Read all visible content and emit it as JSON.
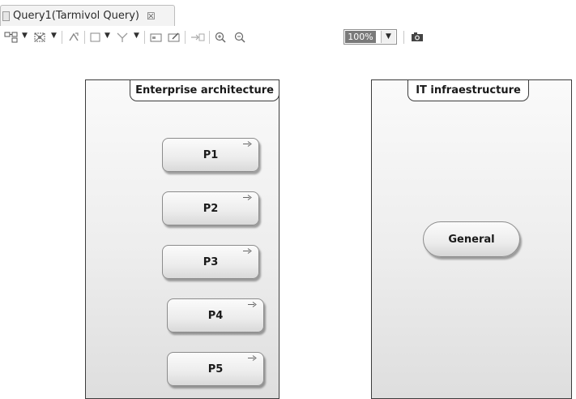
{
  "tab": {
    "title": "Query1(Tarmivol Query)",
    "close_symbol": "☒"
  },
  "toolbar": {
    "icons": [
      "layout-icon",
      "auto-layout-icon",
      "refresh-icon",
      "shape-icon",
      "filter-icon",
      "view-icon",
      "edit-view-icon",
      "export-icon",
      "zoom-in-icon",
      "zoom-out-icon",
      "camera-icon"
    ],
    "zoom_level": "100%"
  },
  "diagram": {
    "containers": [
      {
        "title": "Enterprise architecture",
        "nodes": [
          {
            "label": "P1",
            "icon": "process-arrow-icon"
          },
          {
            "label": "P2",
            "icon": "process-arrow-icon"
          },
          {
            "label": "P3",
            "icon": "process-arrow-icon"
          },
          {
            "label": "P4",
            "icon": "process-arrow-icon"
          },
          {
            "label": "P5",
            "icon": "process-arrow-icon"
          }
        ]
      },
      {
        "title": "IT infraestructure",
        "nodes": [
          {
            "label": "General"
          }
        ]
      }
    ]
  }
}
